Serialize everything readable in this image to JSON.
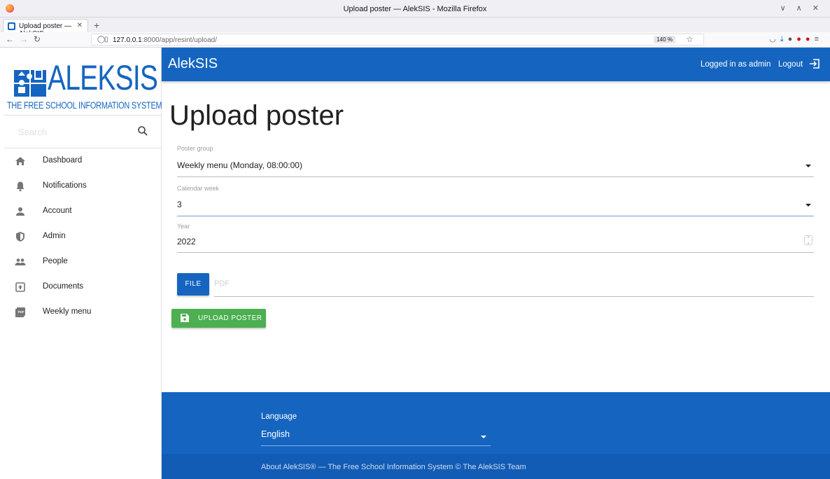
{
  "browser": {
    "window_title": "Upload poster — AlekSIS - Mozilla Firefox",
    "tab_title": "Upload poster — AlekSIS",
    "url_host": "127.0.0.1",
    "url_path": ":8000/app/resint/upload/",
    "zoom": "140 %"
  },
  "sidebar": {
    "logo_word": "ALEKSIS",
    "logo_tagline": "THE FREE SCHOOL INFORMATION SYSTEM",
    "search_placeholder": "Search",
    "items": [
      {
        "label": "Dashboard",
        "icon": "home-icon"
      },
      {
        "label": "Notifications",
        "icon": "bell-icon"
      },
      {
        "label": "Account",
        "icon": "person-icon"
      },
      {
        "label": "Admin",
        "icon": "shield-icon"
      },
      {
        "label": "People",
        "icon": "people-icon"
      },
      {
        "label": "Documents",
        "icon": "upload-document-icon"
      },
      {
        "label": "Weekly menu",
        "icon": "pdf-icon"
      }
    ]
  },
  "header": {
    "brand": "AlekSIS",
    "logged_in": "Logged in as admin",
    "logout": "Logout"
  },
  "form": {
    "title": "Upload poster",
    "poster_group_label": "Poster group",
    "poster_group_value": "Weekly menu (Monday, 08:00:00)",
    "calendar_week_label": "Calendar week",
    "calendar_week_value": "3",
    "year_label": "Year",
    "year_value": "2022",
    "file_button": "FILE",
    "file_placeholder": "PDF",
    "upload_button": "UPLOAD POSTER"
  },
  "footer": {
    "language_label": "Language",
    "language_value": "English",
    "copyright": "About AlekSIS® — The Free School Information System © The AlekSIS Team"
  },
  "colors": {
    "primary": "#1565c0",
    "success": "#4caf50"
  }
}
